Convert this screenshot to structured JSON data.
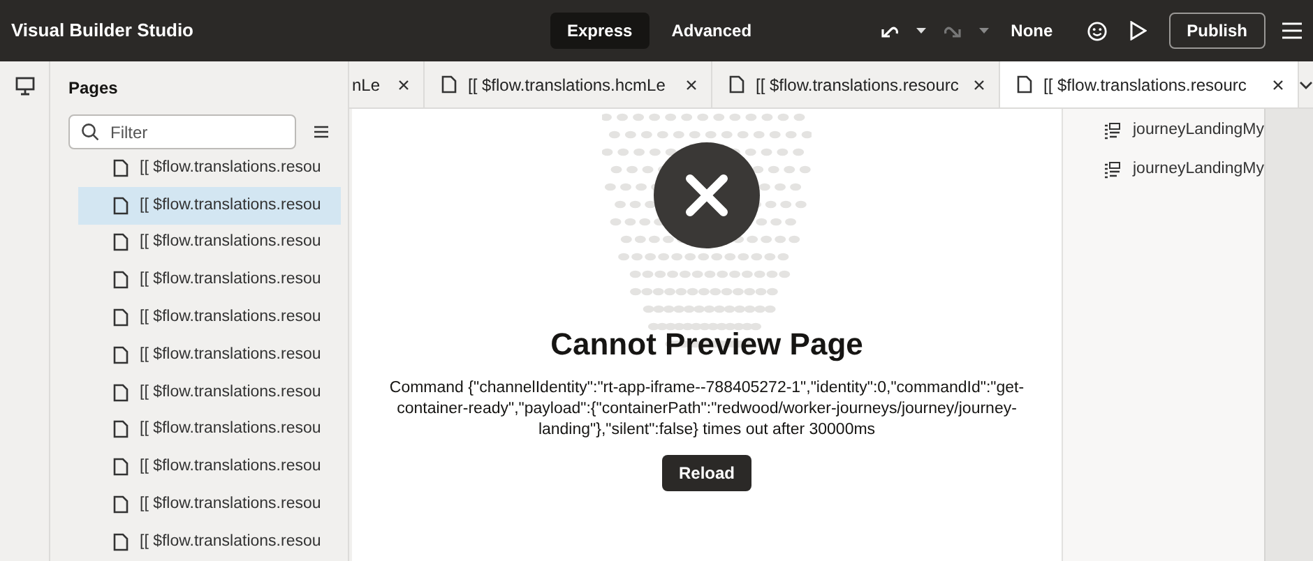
{
  "app": {
    "title": "Visual Builder Studio"
  },
  "modes": [
    {
      "label": "Express",
      "selected": true
    },
    {
      "label": "Advanced",
      "selected": false
    }
  ],
  "toolbar": {
    "undo_disabled": false,
    "redo_disabled": true,
    "theme": "None",
    "publish": "Publish"
  },
  "pages_panel": {
    "title": "Pages",
    "filter": {
      "placeholder": "Filter"
    },
    "items": [
      {
        "label": "[[ $flow.translations.resou",
        "selected": false
      },
      {
        "label": "[[ $flow.translations.resou",
        "selected": true
      },
      {
        "label": "[[ $flow.translations.resou",
        "selected": false
      },
      {
        "label": "[[ $flow.translations.resou",
        "selected": false
      },
      {
        "label": "[[ $flow.translations.resou",
        "selected": false
      },
      {
        "label": "[[ $flow.translations.resou",
        "selected": false
      },
      {
        "label": "[[ $flow.translations.resou",
        "selected": false
      },
      {
        "label": "[[ $flow.translations.resou",
        "selected": false
      },
      {
        "label": "[[ $flow.translations.resou",
        "selected": false
      },
      {
        "label": "[[ $flow.translations.resou",
        "selected": false
      },
      {
        "label": "[[ $flow.translations.resou",
        "selected": false
      }
    ]
  },
  "tabs": [
    {
      "label": "nLe",
      "selected": false,
      "icon": false
    },
    {
      "label": "[[ $flow.translations.hcmLe",
      "selected": false,
      "icon": true
    },
    {
      "label": "[[ $flow.translations.resourc",
      "selected": false,
      "icon": true
    },
    {
      "label": "[[ $flow.translations.resourc",
      "selected": true,
      "icon": true
    }
  ],
  "preview": {
    "title": "Cannot Preview Page",
    "message": "Command {\"channelIdentity\":\"rt-app-iframe--788405272-1\",\"identity\":0,\"commandId\":\"get-container-ready\",\"payload\":{\"containerPath\":\"redwood/worker-journeys/journey/journey-landing\"},\"silent\":false} times out after 30000ms",
    "button": "Reload"
  },
  "structure": {
    "items": [
      "journeyLandingMy",
      "journeyLandingMy"
    ]
  }
}
